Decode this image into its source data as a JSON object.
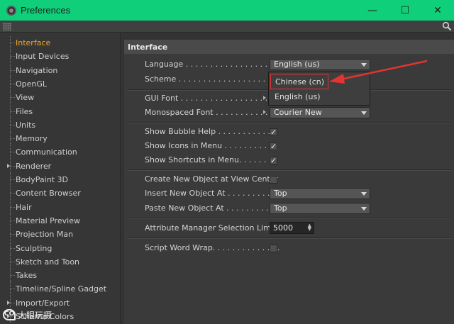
{
  "window": {
    "title": "Preferences",
    "minimize": "—",
    "maximize": "☐",
    "close": "✕",
    "accent": "#0fcf7a"
  },
  "sidebar": {
    "items": [
      {
        "label": "Interface",
        "active": true,
        "expandable": false
      },
      {
        "label": "Input Devices",
        "active": false,
        "expandable": false
      },
      {
        "label": "Navigation",
        "active": false,
        "expandable": false
      },
      {
        "label": "OpenGL",
        "active": false,
        "expandable": false
      },
      {
        "label": "View",
        "active": false,
        "expandable": false
      },
      {
        "label": "Files",
        "active": false,
        "expandable": false
      },
      {
        "label": "Units",
        "active": false,
        "expandable": false
      },
      {
        "label": "Memory",
        "active": false,
        "expandable": false
      },
      {
        "label": "Communication",
        "active": false,
        "expandable": false
      },
      {
        "label": "Renderer",
        "active": false,
        "expandable": true
      },
      {
        "label": "BodyPaint 3D",
        "active": false,
        "expandable": false
      },
      {
        "label": "Content Browser",
        "active": false,
        "expandable": false
      },
      {
        "label": "Hair",
        "active": false,
        "expandable": false
      },
      {
        "label": "Material Preview",
        "active": false,
        "expandable": false
      },
      {
        "label": "Projection Man",
        "active": false,
        "expandable": false
      },
      {
        "label": "Sculpting",
        "active": false,
        "expandable": false
      },
      {
        "label": "Sketch and Toon",
        "active": false,
        "expandable": false
      },
      {
        "label": "Takes",
        "active": false,
        "expandable": false
      },
      {
        "label": "Timeline/Spline Gadget",
        "active": false,
        "expandable": false
      },
      {
        "label": "Import/Export",
        "active": false,
        "expandable": true
      },
      {
        "label": "Scheme Colors",
        "active": false,
        "expandable": true
      }
    ]
  },
  "panel": {
    "header": "Interface",
    "language_label": "Language . . . . . . . . . . . . . . . . . . . .",
    "language_value": "English (us)",
    "scheme_label": "Scheme . . . . . . . . . . . . . . . . . . . . . . .",
    "gui_font_label": "GUI Font . . . . . . . . . . . . . . . . . . .",
    "mono_font_label": "Monospaced Font . . . . . . . . . . .",
    "mono_font_value": "Courier New",
    "bubble_help_label": "Show Bubble Help . . . . . . . . . . . .",
    "bubble_help_checked": "✓",
    "icons_menu_label": "Show Icons in Menu . . . . . . . . . .",
    "icons_menu_checked": "✓",
    "shortcuts_menu_label": "Show Shortcuts in Menu. . . . . . . .",
    "shortcuts_menu_checked": "✓",
    "create_center_label": "Create New Object at View Center",
    "insert_label": "Insert New Object At . . . . . . . . . .",
    "insert_value": "Top",
    "paste_label": "Paste New Object At . . . . . . . . . . .",
    "paste_value": "Top",
    "attr_limit_label": "Attribute Manager Selection Limit",
    "attr_limit_value": "5000",
    "word_wrap_label": "Script Word Wrap. . . . . . . . . . . . . ."
  },
  "popup": {
    "items": [
      "Chinese (cn)",
      "English (us)"
    ],
    "highlight_color": "#e3342f"
  },
  "watermark": {
    "logo": "CO",
    "text": "大眼玩摄"
  }
}
